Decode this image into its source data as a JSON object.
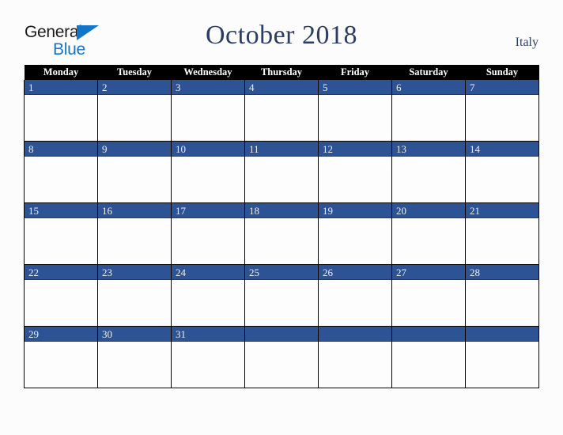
{
  "brand": {
    "name_part1": "General",
    "name_part2": "Blue",
    "triangle_color": "#1175c8"
  },
  "header": {
    "title": "October 2018",
    "locale": "Italy",
    "title_color": "#2c3c63"
  },
  "calendar": {
    "weekday_headers": [
      "Monday",
      "Tuesday",
      "Wednesday",
      "Thursday",
      "Friday",
      "Saturday",
      "Sunday"
    ],
    "header_bg": "#000000",
    "header_text_color": "#FFFFFF",
    "date_bar_color": "#2E5395",
    "date_text_color": "#EDEFF4",
    "cell_bg": "#FDFDFD",
    "weeks": [
      {
        "days": [
          {
            "num": "1"
          },
          {
            "num": "2"
          },
          {
            "num": "3"
          },
          {
            "num": "4"
          },
          {
            "num": "5"
          },
          {
            "num": "6"
          },
          {
            "num": "7"
          }
        ]
      },
      {
        "days": [
          {
            "num": "8"
          },
          {
            "num": "9"
          },
          {
            "num": "10"
          },
          {
            "num": "11"
          },
          {
            "num": "12"
          },
          {
            "num": "13"
          },
          {
            "num": "14"
          }
        ]
      },
      {
        "days": [
          {
            "num": "15"
          },
          {
            "num": "16"
          },
          {
            "num": "17"
          },
          {
            "num": "18"
          },
          {
            "num": "19"
          },
          {
            "num": "20"
          },
          {
            "num": "21"
          }
        ]
      },
      {
        "days": [
          {
            "num": "22"
          },
          {
            "num": "23"
          },
          {
            "num": "24"
          },
          {
            "num": "25"
          },
          {
            "num": "26"
          },
          {
            "num": "27"
          },
          {
            "num": "28"
          }
        ]
      },
      {
        "days": [
          {
            "num": "29"
          },
          {
            "num": "30"
          },
          {
            "num": "31"
          },
          {
            "num": ""
          },
          {
            "num": ""
          },
          {
            "num": ""
          },
          {
            "num": ""
          }
        ]
      }
    ]
  }
}
